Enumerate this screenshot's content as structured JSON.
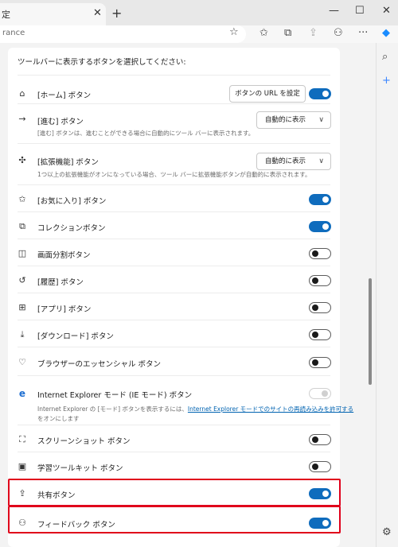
{
  "tab": {
    "title": "定",
    "close": "✕",
    "new_tab": "+"
  },
  "window": {
    "minimize": "—",
    "maximize": "☐",
    "close": "✕"
  },
  "address": {
    "url": "rance"
  },
  "toolbar_icons": [
    "star-outline-icon",
    "favorites-icon",
    "collections-icon",
    "share-icon",
    "extensions-icon",
    "more-icon",
    "copilot-icon"
  ],
  "heading": "ツールバーに表示するボタンを選択してください:",
  "rows": {
    "home": {
      "label": "[ホーム] ボタン",
      "button": "ボタンの URL を設定",
      "toggle": "on"
    },
    "forward": {
      "label": "[進む] ボタン",
      "desc": "[進む] ボタンは、進むことができる場合に自動的にツール バーに表示されます。",
      "select": "自動的に表示"
    },
    "extensions": {
      "label": "[拡張機能] ボタン",
      "desc": "1つ以上の拡張機能がオンになっている場合、ツール バーに拡張機能ボタンが自動的に表示されます。",
      "select": "自動的に表示"
    },
    "favorites": {
      "label": "[お気に入り] ボタン",
      "toggle": "on"
    },
    "collections": {
      "label": "コレクションボタン",
      "toggle": "on"
    },
    "split": {
      "label": "画面分割ボタン",
      "toggle": "off"
    },
    "history": {
      "label": "[履歴] ボタン",
      "toggle": "off"
    },
    "apps": {
      "label": "[アプリ] ボタン",
      "toggle": "off"
    },
    "downloads": {
      "label": "[ダウンロード] ボタン",
      "toggle": "off"
    },
    "essentials": {
      "label": "ブラウザーのエッセンシャル ボタン",
      "toggle": "off"
    },
    "ie": {
      "label": "Internet Explorer モード (IE モード) ボタン",
      "desc_prefix": "Internet Explorer の [モード] ボタンを表示するには、",
      "desc_link": "Internet Explorer モードでのサイトの再読み込みを許可する",
      "desc_suffix": "をオンにします",
      "toggle": "disabled"
    },
    "screenshot": {
      "label": "スクリーンショット ボタン",
      "toggle": "off"
    },
    "learning": {
      "label": "学習ツールキット ボタン",
      "toggle": "off"
    },
    "share": {
      "label": "共有ボタン",
      "toggle": "on"
    },
    "feedback": {
      "label": "フィードバック ボタン",
      "toggle": "on"
    }
  },
  "chevron": "∨",
  "colors": {
    "accent": "#0f6cbd",
    "highlight": "#e0001b"
  }
}
